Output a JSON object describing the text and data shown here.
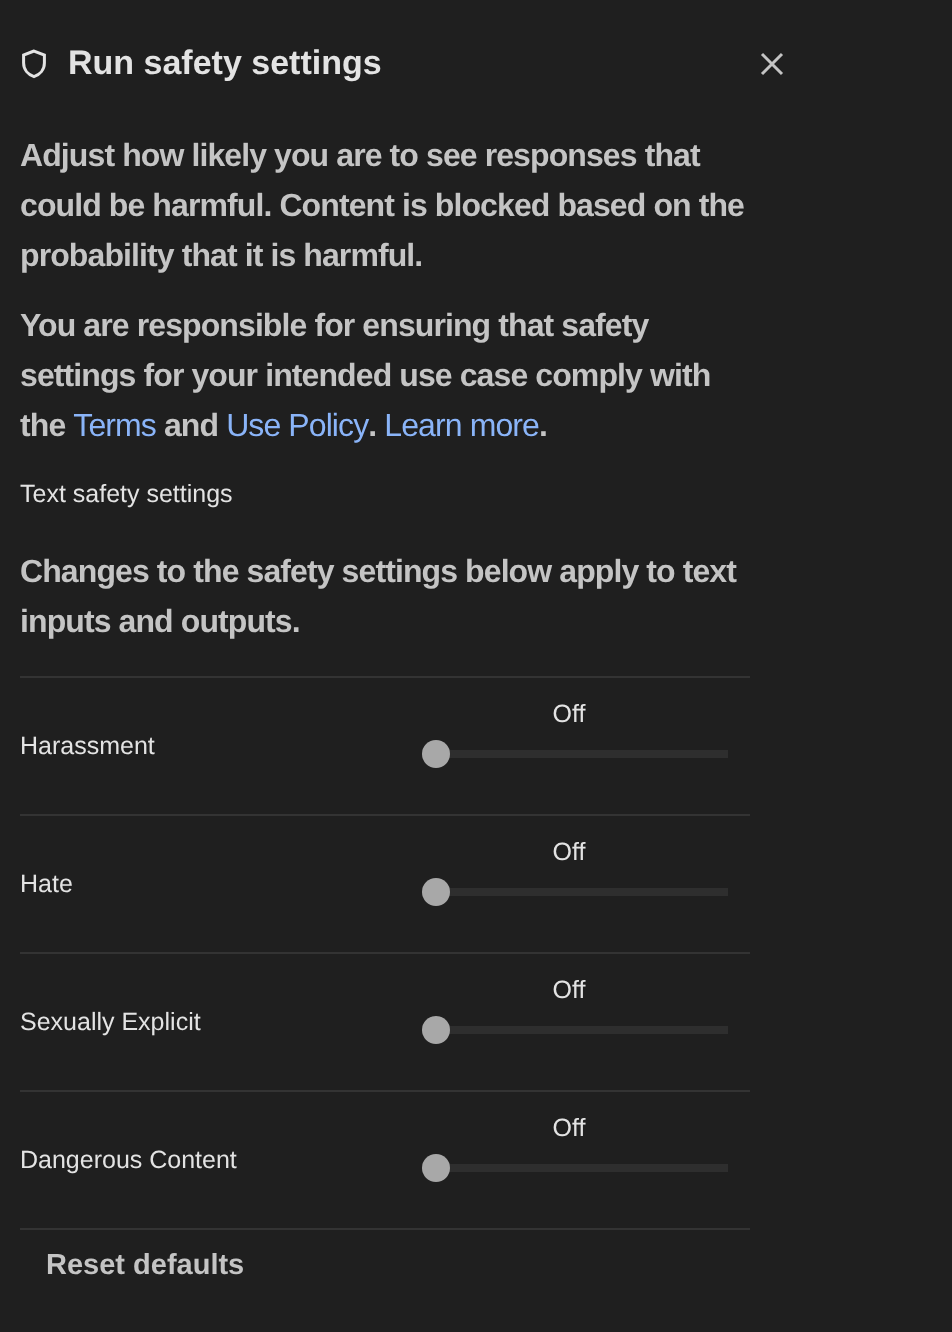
{
  "panel": {
    "title": "Run safety settings"
  },
  "intro": "Adjust how likely you are to see responses that could be harmful. Content is blocked based on the probability that it is harmful.",
  "notice": [
    {
      "kind": "text",
      "text": "You are responsible for ensuring that safety settings for your intended use case comply with the "
    },
    {
      "kind": "link",
      "text": "Terms"
    },
    {
      "kind": "text",
      "text": " and "
    },
    {
      "kind": "link",
      "text": "Use Policy"
    },
    {
      "kind": "text",
      "text": ". "
    },
    {
      "kind": "link",
      "text": "Learn more"
    },
    {
      "kind": "text",
      "text": "."
    }
  ],
  "section_title": "Text safety settings",
  "section_note": "Changes to the safety settings below apply to text inputs and outputs.",
  "settings": [
    {
      "name": "Harassment",
      "reading": "Off",
      "level": 0
    },
    {
      "name": "Hate",
      "reading": "Off",
      "level": 0
    },
    {
      "name": "Sexually Explicit",
      "reading": "Off",
      "level": 0
    },
    {
      "name": "Dangerous Content",
      "reading": "Off",
      "level": 0
    }
  ],
  "reset_button": "Reset defaults"
}
